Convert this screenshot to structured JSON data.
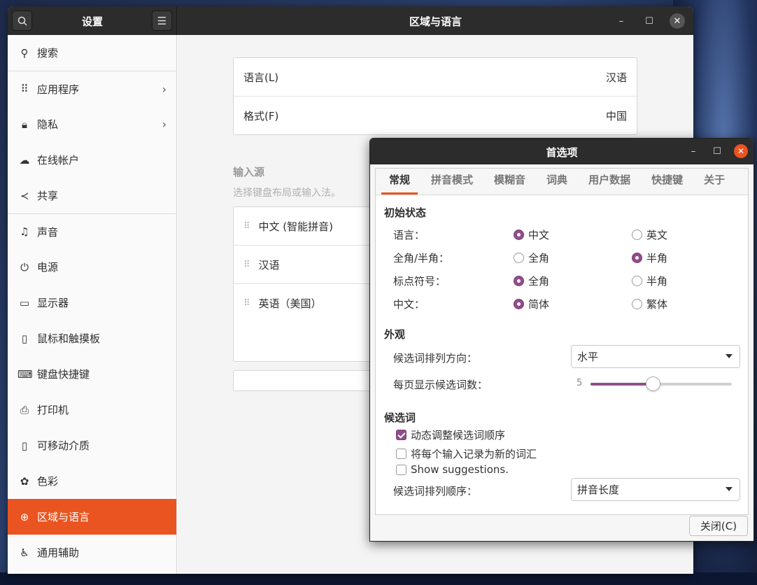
{
  "settings": {
    "sidebar_title": "设置",
    "main_title": "区域与语言",
    "sidebar_items": [
      {
        "label": "搜索",
        "icon": "search-icon"
      },
      {
        "label": "应用程序",
        "icon": "apps-grid-icon"
      },
      {
        "label": "隐私",
        "icon": "lock-icon"
      },
      {
        "label": "在线帐户",
        "icon": "cloud-icon"
      },
      {
        "label": "共享",
        "icon": "share-icon"
      },
      {
        "label": "声音",
        "icon": "music-note-icon"
      },
      {
        "label": "电源",
        "icon": "power-icon"
      },
      {
        "label": "显示器",
        "icon": "display-icon"
      },
      {
        "label": "鼠标和触摸板",
        "icon": "mouse-icon"
      },
      {
        "label": "键盘快捷键",
        "icon": "keyboard-icon"
      },
      {
        "label": "打印机",
        "icon": "printer-icon"
      },
      {
        "label": "可移动介质",
        "icon": "removable-media-icon"
      },
      {
        "label": "色彩",
        "icon": "color-icon"
      },
      {
        "label": "区域与语言",
        "icon": "globe-icon"
      },
      {
        "label": "通用辅助",
        "icon": "accessibility-icon"
      }
    ],
    "language_row": {
      "label": "语言(L)",
      "value": "汉语"
    },
    "format_row": {
      "label": "格式(F)",
      "value": "中国"
    },
    "input_sources": {
      "title": "输入源",
      "subtitle": "选择键盘布局或输入法。",
      "items": [
        "中文 (智能拼音)",
        "汉语",
        "英语（美国）"
      ]
    }
  },
  "prefs": {
    "title": "首选项",
    "tabs": [
      "常规",
      "拼音模式",
      "模糊音",
      "词典",
      "用户数据",
      "快捷键",
      "关于"
    ],
    "initial_state": {
      "title": "初始状态",
      "rows": [
        {
          "label": "语言：",
          "opt1": "中文",
          "opt2": "英文",
          "selected": 1
        },
        {
          "label": "全角/半角：",
          "opt1": "全角",
          "opt2": "半角",
          "selected": 2
        },
        {
          "label": "标点符号：",
          "opt1": "全角",
          "opt2": "半角",
          "selected": 1
        },
        {
          "label": "中文：",
          "opt1": "简体",
          "opt2": "繁体",
          "selected": 1
        }
      ]
    },
    "appearance": {
      "title": "外观",
      "orientation_label": "候选词排列方向：",
      "orientation_value": "水平",
      "page_size_label": "每页显示候选词数：",
      "page_size_value": "5",
      "page_size_fraction": 0.44
    },
    "candidates": {
      "title": "候选词",
      "checks": [
        {
          "label": "动态调整候选词顺序",
          "checked": true
        },
        {
          "label": "将每个输入记录为新的词汇",
          "checked": false
        },
        {
          "label": "Show suggestions.",
          "checked": false
        }
      ],
      "sort_label": "候选词排列顺序：",
      "sort_value": "拼音长度"
    },
    "close_label": "关闭(C)"
  },
  "colors": {
    "accent": "#e95420",
    "check": "#924d8b",
    "header": "#2c2c2c"
  }
}
